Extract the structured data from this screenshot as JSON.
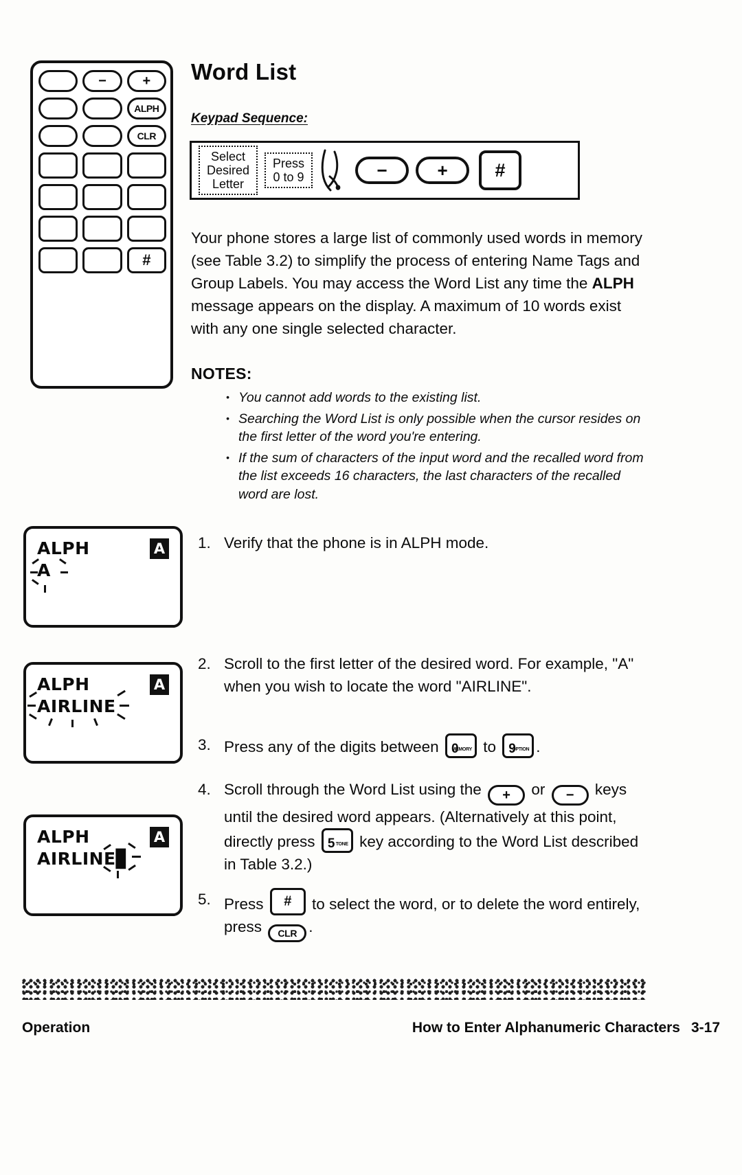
{
  "document": {
    "title": "Word List",
    "subheading": "Keypad Sequence:"
  },
  "phone_illustration": {
    "rows": [
      [
        {
          "label": "",
          "shape": "pill"
        },
        {
          "label": "−",
          "shape": "pill"
        },
        {
          "label": "+",
          "shape": "pill"
        }
      ],
      [
        {
          "label": "",
          "shape": "pill"
        },
        {
          "label": "",
          "shape": "pill"
        },
        {
          "label": "ALPH",
          "shape": "pill"
        }
      ],
      [
        {
          "label": "",
          "shape": "pill"
        },
        {
          "label": "",
          "shape": "pill"
        },
        {
          "label": "CLR",
          "shape": "pill"
        }
      ],
      [
        {
          "label": "",
          "shape": "square"
        },
        {
          "label": "",
          "shape": "square"
        },
        {
          "label": "",
          "shape": "square"
        }
      ],
      [
        {
          "label": "",
          "shape": "square"
        },
        {
          "label": "",
          "shape": "square"
        },
        {
          "label": "",
          "shape": "square"
        }
      ],
      [
        {
          "label": "",
          "shape": "square"
        },
        {
          "label": "",
          "shape": "square"
        },
        {
          "label": "",
          "shape": "square"
        }
      ],
      [
        {
          "label": "",
          "shape": "square"
        },
        {
          "label": "",
          "shape": "square"
        },
        {
          "label": "#",
          "shape": "square"
        }
      ]
    ]
  },
  "keypad_sequence": {
    "step_a": "Select\nDesired\nLetter",
    "step_b": "Press\n0 to 9",
    "minus_key": "−",
    "plus_key": "+",
    "hash_key": "#"
  },
  "body_text": {
    "paragraph_lead": "Your phone stores a large list of commonly used words in memory (see Table 3.2) to simplify the process of entering Name Tags and Group Labels.  You may access the Word List any time the ",
    "paragraph_bold": "ALPH",
    "paragraph_tail": " message appears on the display.  A maximum of 10 words exist with any one single selected character."
  },
  "notes": {
    "heading": "NOTES:",
    "items": [
      "You cannot add words to the existing list.",
      "Searching the Word List is only possible when the cursor resides on the first letter of the word you're entering.",
      "If the sum of characters of the input word and the recalled word from the list exceeds 16 characters, the last characters of the recalled word are lost."
    ]
  },
  "displays": [
    {
      "line1": "ALPH",
      "line2": "A",
      "badge": "A"
    },
    {
      "line1": "ALPH",
      "line2": "AIRLINE",
      "badge": "A"
    },
    {
      "line1": "ALPH",
      "line2": "AIRLINE",
      "badge": "A",
      "cursor": "▊"
    }
  ],
  "steps": [
    {
      "number": "1.",
      "text_1": "Verify that the phone is in ALPH mode."
    },
    {
      "number": "2.",
      "text_1": "Scroll to the first letter of the desired word.  For example, \"A\" when you wish to locate the word \"AIRLINE\"."
    },
    {
      "number": "3.",
      "text_1": "Press any of the digits between",
      "key_0_digit": "0",
      "key_0_sub": "MEMORY",
      "text_2": "to",
      "key_9_digit": "9",
      "key_9_sub": "OPTION",
      "text_3": "."
    },
    {
      "number": "4.",
      "text_1": "Scroll through the Word List using the",
      "plus_key": "+",
      "text_2": "or",
      "minus_key": "−",
      "text_3": "keys until the desired word appears.  (Alternatively at this point, directly press",
      "key_5_digit": "5",
      "key_5_sub": "TONE",
      "text_4": "key according to the Word List described in Table 3.2.)"
    },
    {
      "number": "5.",
      "text_1": "Press",
      "hash_key": "#",
      "text_2": "to select the word, or to delete the word entirely, press",
      "clr_key": "CLR",
      "text_3": "."
    }
  ],
  "footer": {
    "left": "Operation",
    "right": "How to Enter Alphanumeric Characters",
    "page_number": "3-17"
  }
}
